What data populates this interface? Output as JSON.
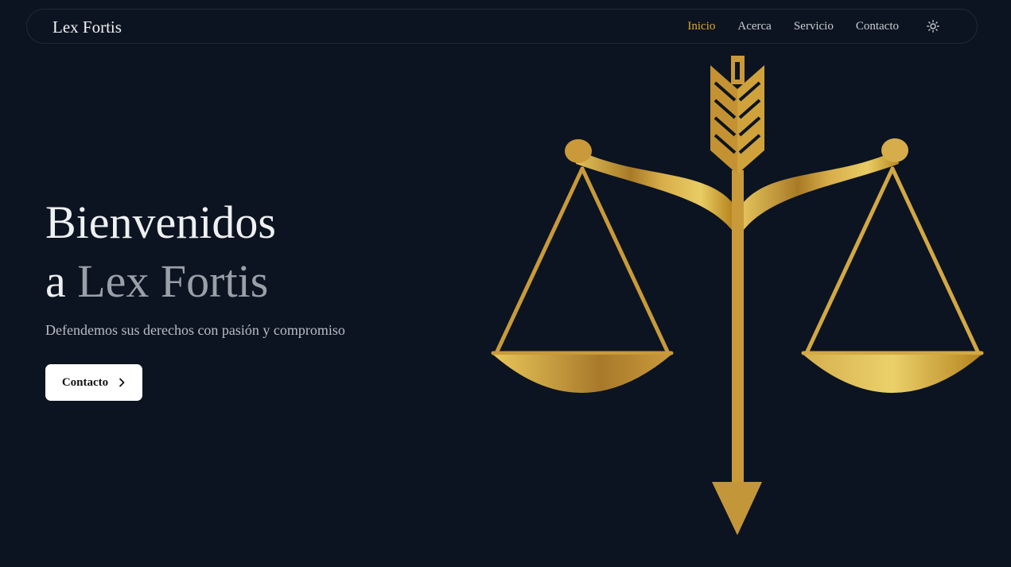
{
  "header": {
    "brand": "Lex Fortis",
    "nav": [
      {
        "label": "Inicio",
        "active": true
      },
      {
        "label": "Acerca"
      },
      {
        "label": "Servicio"
      },
      {
        "label": "Contacto"
      }
    ],
    "theme_toggle_icon": "sun-icon"
  },
  "hero": {
    "title_line1": "Bienvenidos",
    "title_prefix": "a",
    "title_highlight": "Lex Fortis",
    "subtitle": "Defendemos sus derechos con pasión y compromiso",
    "cta_label": "Contacto",
    "cta_icon": "chevron-right-icon"
  },
  "illustration": "scales-of-justice-arrow",
  "colors": {
    "background": "#0c1421",
    "accent": "#e0ab2a",
    "gold": "#c9962e"
  }
}
